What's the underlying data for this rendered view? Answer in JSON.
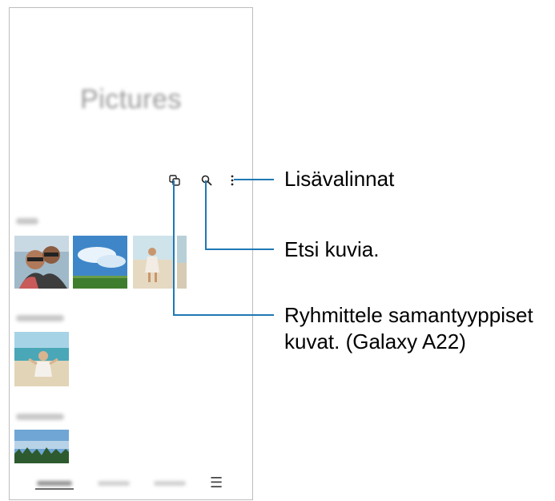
{
  "app": {
    "title": "Pictures"
  },
  "toolbar": {
    "group_icon": "group-similar-icon",
    "search_icon": "search-icon",
    "more_icon": "more-options-icon"
  },
  "bottom_nav": {
    "menu_icon": "menu-icon",
    "menu_glyph": "☰"
  },
  "callouts": {
    "more_options": "Lisävalinnat",
    "search": "Etsi kuvia.",
    "group_line1": "Ryhmittele samantyyppiset",
    "group_line2": "kuvat. (Galaxy A22)"
  },
  "colors": {
    "callout_line": "#1f78b4"
  }
}
